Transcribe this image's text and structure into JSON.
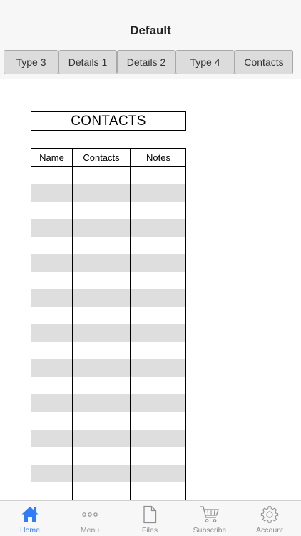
{
  "nav": {
    "title": "Default"
  },
  "tabs": [
    {
      "label": "Type 3"
    },
    {
      "label": "Details 1"
    },
    {
      "label": "Details 2"
    },
    {
      "label": "Type 4"
    },
    {
      "label": "Contacts"
    }
  ],
  "content": {
    "title": "CONTACTS",
    "table": {
      "columns": [
        "Name",
        "Contacts",
        "Notes"
      ]
    }
  },
  "tabbar": {
    "items": [
      {
        "label": "Home",
        "icon": "home-icon",
        "active": true
      },
      {
        "label": "Menu",
        "icon": "ellipsis-icon",
        "active": false
      },
      {
        "label": "Files",
        "icon": "file-icon",
        "active": false
      },
      {
        "label": "Subscribe",
        "icon": "cart-icon",
        "active": false
      },
      {
        "label": "Account",
        "icon": "gear-icon",
        "active": false
      }
    ]
  },
  "colors": {
    "accent": "#2f7cf6",
    "inactive": "#8e8e93",
    "row_stripe": "#dedede"
  }
}
